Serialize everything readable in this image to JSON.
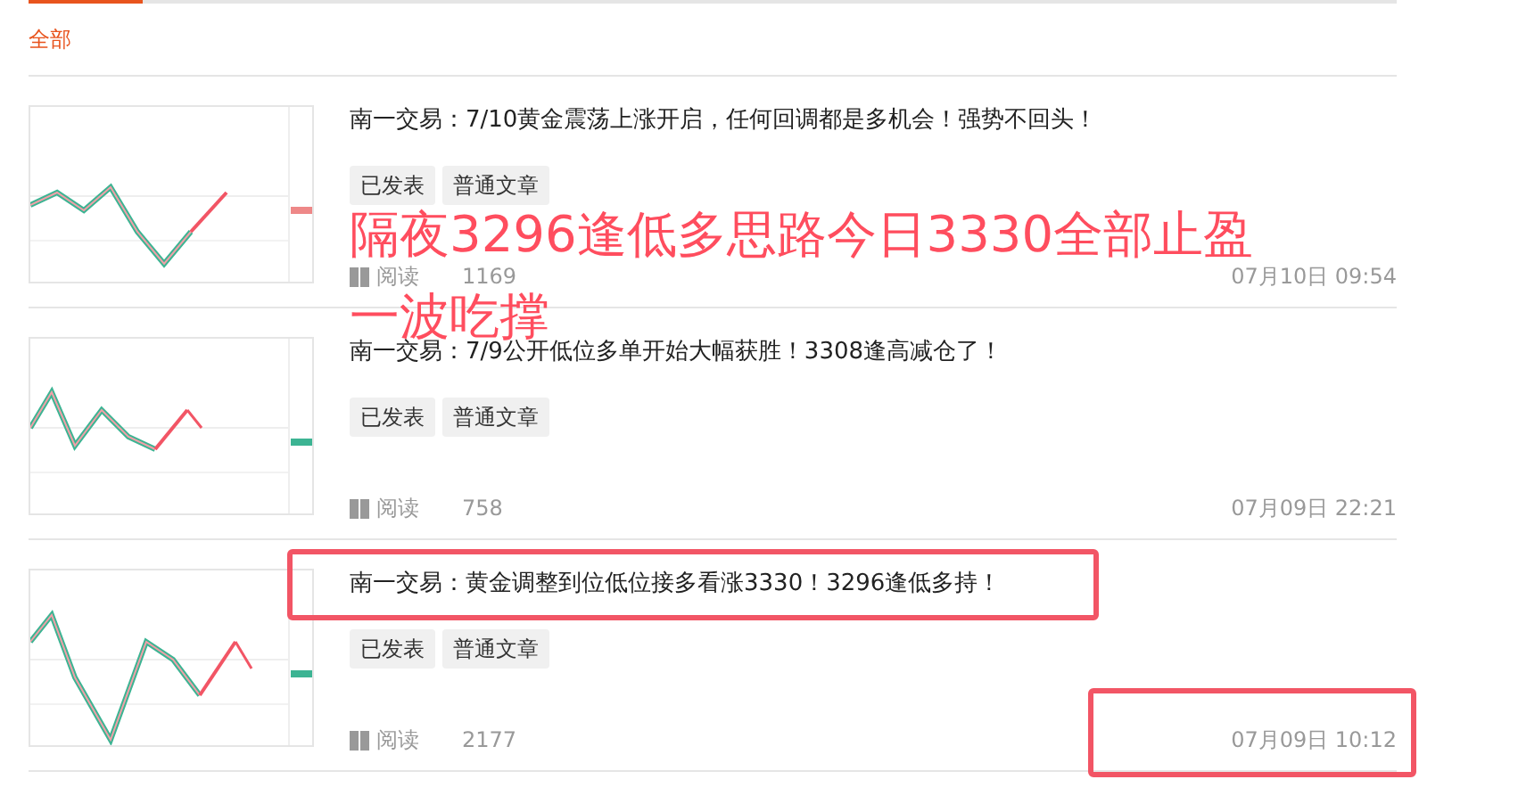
{
  "tabs": [
    {
      "label": "全部",
      "selected": true
    }
  ],
  "articles": [
    {
      "title": "南一交易：7/10黄金震荡上涨开启，任何回调都是多机会！强势不回头！",
      "tags": [
        "已发表",
        "普通文章"
      ],
      "read_label": "阅读",
      "reads": "1169",
      "date": "07月10日 09:54"
    },
    {
      "title": "南一交易：7/9公开低位多单开始大幅获胜！3308逢高减仓了！",
      "tags": [
        "已发表",
        "普通文章"
      ],
      "read_label": "阅读",
      "reads": "758",
      "date": "07月09日 22:21"
    },
    {
      "title": "南一交易：黄金调整到位低位接多看涨3330！3296逢低多持！",
      "tags": [
        "已发表",
        "普通文章"
      ],
      "read_label": "阅读",
      "reads": "2177",
      "date": "07月09日 10:12"
    }
  ],
  "overlay_note": [
    "隔夜3296逢低多思路今日3330全部止盈",
    "一波吃撑"
  ]
}
